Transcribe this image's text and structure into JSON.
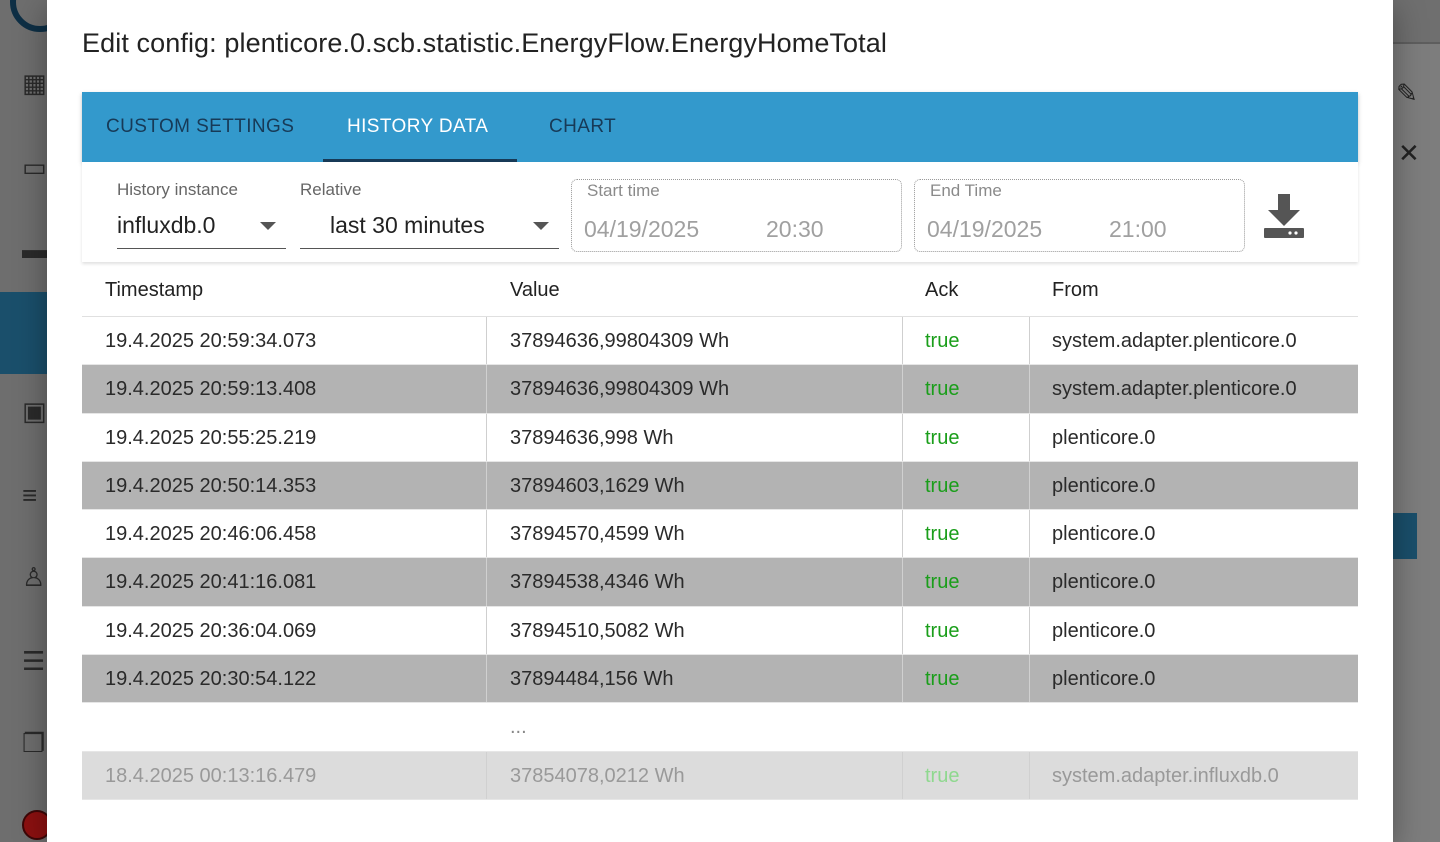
{
  "dialog": {
    "title": "Edit config: plenticore.0.scb.statistic.EnergyFlow.EnergyHomeTotal"
  },
  "tabs": [
    {
      "label": "CUSTOM SETTINGS"
    },
    {
      "label": "HISTORY DATA",
      "active": true
    },
    {
      "label": "CHART"
    }
  ],
  "controls": {
    "history_instance": {
      "label": "History instance",
      "value": "influxdb.0"
    },
    "relative": {
      "label": "Relative",
      "value": "last 30 minutes"
    },
    "start_time": {
      "label": "Start time",
      "date": "04/19/2025",
      "time": "20:30"
    },
    "end_time": {
      "label": "End Time",
      "date": "04/19/2025",
      "time": "21:00"
    },
    "download_icon": "download-icon"
  },
  "table": {
    "headers": [
      "Timestamp",
      "Value",
      "Ack",
      "From"
    ],
    "rows": [
      {
        "ts": "19.4.2025 20:59:34.073",
        "value": "37894636,99804309 Wh",
        "ack": "true",
        "from": "system.adapter.plenticore.0"
      },
      {
        "ts": "19.4.2025 20:59:13.408",
        "value": "37894636,99804309 Wh",
        "ack": "true",
        "from": "system.adapter.plenticore.0"
      },
      {
        "ts": "19.4.2025 20:55:25.219",
        "value": "37894636,998 Wh",
        "ack": "true",
        "from": "plenticore.0"
      },
      {
        "ts": "19.4.2025 20:50:14.353",
        "value": "37894603,1629 Wh",
        "ack": "true",
        "from": "plenticore.0"
      },
      {
        "ts": "19.4.2025 20:46:06.458",
        "value": "37894570,4599 Wh",
        "ack": "true",
        "from": "plenticore.0"
      },
      {
        "ts": "19.4.2025 20:41:16.081",
        "value": "37894538,4346 Wh",
        "ack": "true",
        "from": "plenticore.0"
      },
      {
        "ts": "19.4.2025 20:36:04.069",
        "value": "37894510,5082 Wh",
        "ack": "true",
        "from": "plenticore.0"
      },
      {
        "ts": "19.4.2025 20:30:54.122",
        "value": "37894484,156 Wh",
        "ack": "true",
        "from": "plenticore.0"
      }
    ],
    "ellipsis": "...",
    "last_row": {
      "ts": "18.4.2025 00:13:16.479",
      "value": "37854078,0212 Wh",
      "ack": "true",
      "from": "system.adapter.influxdb.0"
    }
  },
  "colors": {
    "tab_bar": "#3399cc",
    "tab_text": "#173a57",
    "ack_true": "#1a9e1a",
    "odd_row": "#b3b3b3"
  }
}
